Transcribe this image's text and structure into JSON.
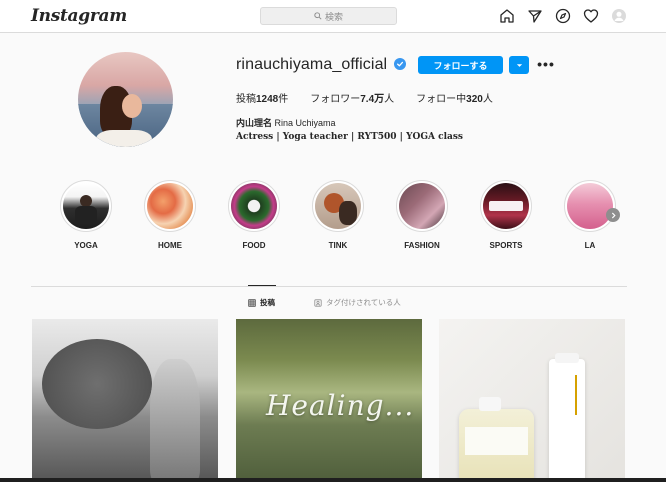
{
  "topbar": {
    "logo": "Instagram",
    "search_placeholder": "検索",
    "icons": [
      "home-icon",
      "direct-icon",
      "explore-icon",
      "heart-icon",
      "profile-avatar-icon"
    ]
  },
  "profile": {
    "username": "rinauchiyama_official",
    "verified": true,
    "follow_label": "フォローする",
    "posts_label": "投稿",
    "posts_count": "1248",
    "posts_unit": "件",
    "followers_label": "フォロワー",
    "followers_count": "7.4万",
    "followers_unit": "人",
    "following_label": "フォロー中",
    "following_count": "320",
    "following_unit": "人",
    "full_name_jp": "内山理名",
    "full_name_en": "Rina Uchiyama",
    "bio": "Actress | Yoga teacher | RYT500 | YOGA class"
  },
  "highlights": [
    {
      "label": "YOGA"
    },
    {
      "label": "HOME"
    },
    {
      "label": "FOOD"
    },
    {
      "label": "TINK"
    },
    {
      "label": "FASHION"
    },
    {
      "label": "SPORTS"
    },
    {
      "label": "LA"
    }
  ],
  "tabs": {
    "posts": "投稿",
    "tagged": "タグ付けされている人"
  },
  "posts": [
    {
      "overlay_text": ""
    },
    {
      "overlay_text": "Healing..."
    },
    {
      "overlay_text": ""
    }
  ],
  "colors": {
    "accent": "#0095f6",
    "verified": "#3897f0",
    "border": "#dbdbdb",
    "background": "#fafafa"
  }
}
